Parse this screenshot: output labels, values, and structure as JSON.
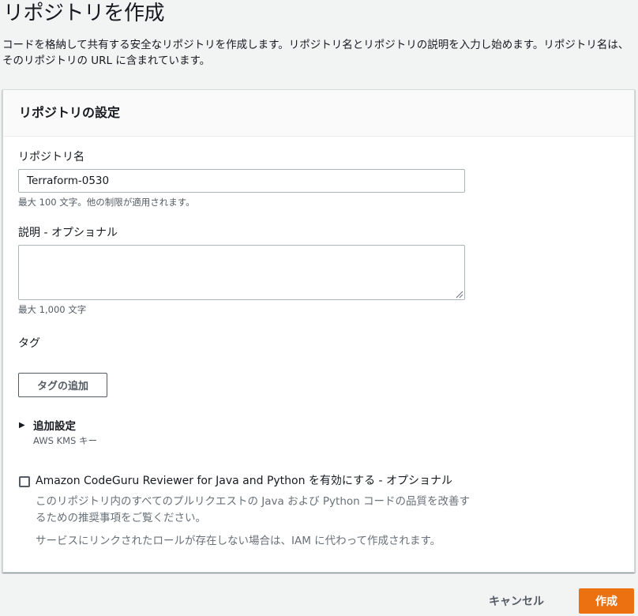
{
  "page": {
    "title": "リポジトリを作成",
    "description": "コードを格納して共有する安全なリポジトリを作成します。リポジトリ名とリポジトリの説明を入力し始めます。リポジトリ名は、そのリポジトリの URL に含まれています。"
  },
  "settings": {
    "header": "リポジトリの設定",
    "repo_name_label": "リポジトリ名",
    "repo_name_value": "Terraform-0530",
    "repo_name_hint": "最大 100 文字。他の制限が適用されます。",
    "description_label": "説明 - オプショナル",
    "description_value": "",
    "description_hint": "最大 1,000 文字",
    "tags_label": "タグ",
    "add_tag_button": "タグの追加",
    "additional_settings_label": "追加設定",
    "additional_settings_sub": "AWS KMS キー",
    "codeguru_label": "Amazon CodeGuru Reviewer for Java and Python を有効にする - オプショナル",
    "codeguru_desc1": "このリポジトリ内のすべてのプルリクエストの Java および Python コードの品質を改善するための推奨事項をご覧ください。",
    "codeguru_desc2": "サービスにリンクされたロールが存在しない場合は、IAM に代わって作成されます。"
  },
  "actions": {
    "cancel": "キャンセル",
    "create": "作成"
  },
  "colors": {
    "primary": "#ec7211",
    "background": "#f2f3f3",
    "panel": "#ffffff"
  }
}
